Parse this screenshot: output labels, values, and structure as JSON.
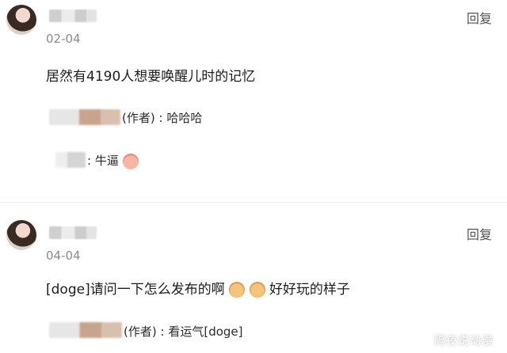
{
  "comments": [
    {
      "date": "02-04",
      "reply_label": "回复",
      "text": "居然有4190人想要唤醒儿时的记忆",
      "replies": [
        {
          "author_tag": "(作者)",
          "separator": ":",
          "text": "哈哈哈"
        },
        {
          "author_tag": "",
          "separator": ":",
          "text": "牛逼"
        }
      ]
    },
    {
      "date": "04-04",
      "reply_label": "回复",
      "text_part1": "[doge]请问一下怎么发布的啊",
      "text_part2": "好好玩的样子",
      "replies": [
        {
          "author_tag": "(作者)",
          "separator": ":",
          "text": "看运气[doge]"
        }
      ]
    }
  ],
  "watermark": "隔夜说动漫",
  "colors": {
    "reply_text": "#555555",
    "date_text": "#8a8a8a",
    "divider": "#ececec"
  },
  "icons": [
    "peach-emoji-icon",
    "crying-emoji-icon"
  ]
}
